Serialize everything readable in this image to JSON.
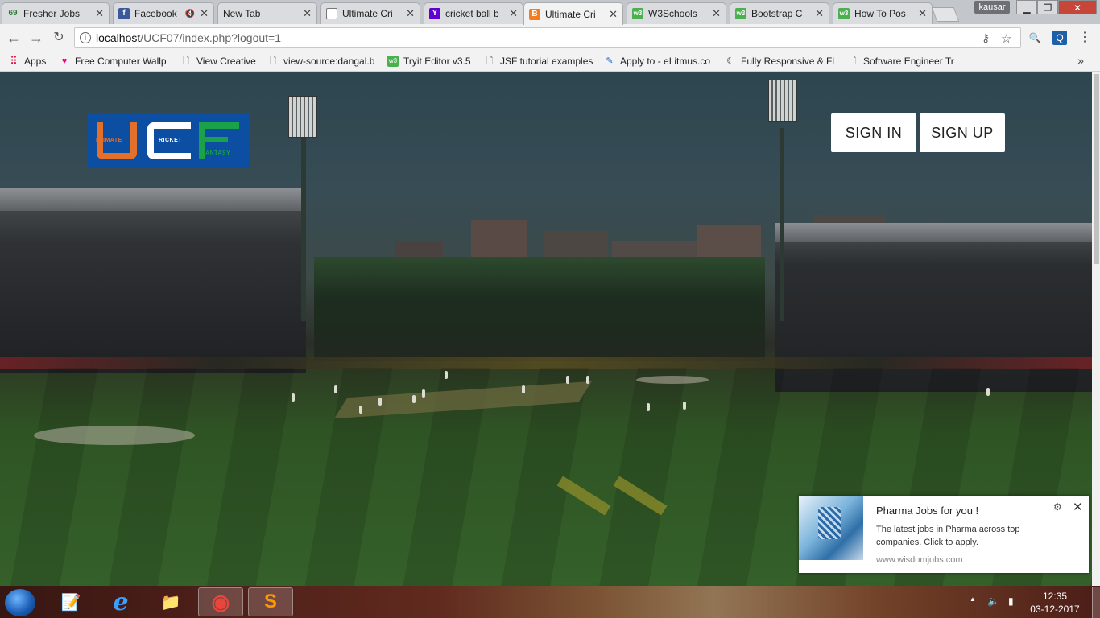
{
  "browser": {
    "tabs": [
      {
        "title": "Fresher Jobs",
        "icon": "jobs-69-icon",
        "favicon_text": "69",
        "color": "#2e7d32"
      },
      {
        "title": "Facebook",
        "icon": "facebook-icon",
        "favicon_text": "f",
        "color": "#3b5998",
        "muted": true
      },
      {
        "title": "New Tab",
        "icon": "",
        "favicon_text": "",
        "color": ""
      },
      {
        "title": "Ultimate Cri",
        "icon": "document-icon",
        "favicon_text": "",
        "color": "#ffffff"
      },
      {
        "title": "cricket ball b",
        "icon": "yahoo-icon",
        "favicon_text": "Y",
        "color": "#5f01d1"
      },
      {
        "title": "Ultimate Cri",
        "icon": "xampp-icon",
        "favicon_text": "B",
        "color": "#f57c1f",
        "active": true
      },
      {
        "title": "W3Schools",
        "icon": "w3schools-icon",
        "favicon_text": "w3",
        "color": "#4caf50"
      },
      {
        "title": "Bootstrap C",
        "icon": "w3schools-icon",
        "favicon_text": "w3",
        "color": "#4caf50"
      },
      {
        "title": "How To Pos",
        "icon": "w3schools-icon",
        "favicon_text": "w3",
        "color": "#4caf50"
      }
    ],
    "user": "kausar",
    "window_controls": {
      "minimize": "▁",
      "maximize": "❐",
      "close": "✕"
    },
    "address": {
      "host": "localhost",
      "path": "/UCF07/index.php?logout=1"
    },
    "bookmarks": [
      {
        "label": "Apps",
        "icon": "apps-grid-icon"
      },
      {
        "label": "Free Computer Wallp",
        "icon": "wallpaper-icon"
      },
      {
        "label": "View Creative",
        "icon": "page-icon"
      },
      {
        "label": "view-source:dangal.b",
        "icon": "page-icon"
      },
      {
        "label": "Tryit Editor v3.5",
        "icon": "w3schools-icon"
      },
      {
        "label": "JSF tutorial examples",
        "icon": "page-icon"
      },
      {
        "label": "Apply to - eLitmus.co",
        "icon": "elitmus-icon"
      },
      {
        "label": "Fully Responsive & Fl",
        "icon": "swirl-icon"
      },
      {
        "label": "Software Engineer Tr",
        "icon": "page-icon"
      }
    ],
    "more_bookmarks": "»"
  },
  "site": {
    "logo": {
      "letters": [
        "U",
        "C",
        "F"
      ],
      "words": [
        "LTIMATE",
        "RICKET",
        "ANTASY"
      ],
      "colors": {
        "u": "#e2702a",
        "c": "#ffffff",
        "f": "#1aa14a",
        "bg": "#0b4ea2"
      }
    },
    "sign_in": "SIGN IN",
    "sign_up": "SIGN UP"
  },
  "notification": {
    "title": "Pharma  Jobs for you !",
    "body": "The latest jobs in Pharma across top companies. Click to apply.",
    "source": "www.wisdomjobs.com",
    "settings_icon": "⚙",
    "close_icon": "✕"
  },
  "taskbar": {
    "apps": [
      {
        "name": "notepadpp-icon",
        "glyph": "📝"
      },
      {
        "name": "internet-explorer-icon",
        "glyph": "e"
      },
      {
        "name": "file-explorer-icon",
        "glyph": "📁"
      },
      {
        "name": "chrome-icon",
        "glyph": "◉",
        "active": true
      },
      {
        "name": "sublime-text-icon",
        "glyph": "S",
        "active": true
      }
    ],
    "tray": {
      "up": "▲",
      "speaker": "🔈",
      "battery": "▮"
    },
    "time": "12:35",
    "date": "03-12-2017"
  }
}
